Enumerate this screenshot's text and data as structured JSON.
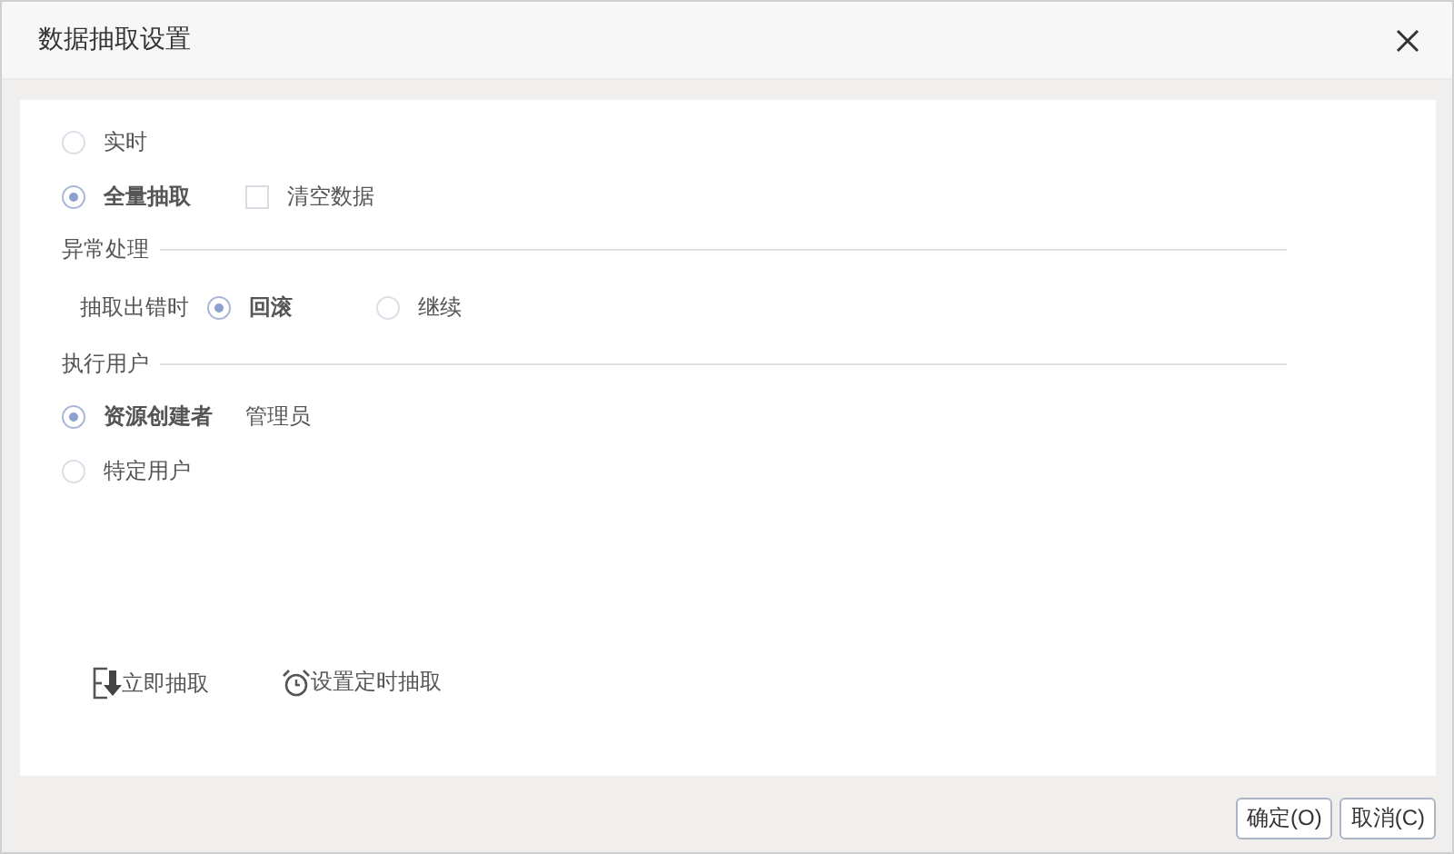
{
  "window": {
    "title": "数据抽取设置"
  },
  "mode_options": [
    {
      "label": "实时",
      "selected": false
    },
    {
      "label": "全量抽取",
      "selected": true,
      "checkbox": {
        "label": "清空数据",
        "checked": false
      }
    }
  ],
  "error_handling": {
    "title": "异常处理",
    "label": "抽取出错时",
    "options": [
      {
        "label": "回滚",
        "selected": true
      },
      {
        "label": "继续",
        "selected": false
      }
    ]
  },
  "exec_user": {
    "title": "执行用户",
    "options": [
      {
        "label": "资源创建者",
        "selected": true,
        "note": "管理员"
      },
      {
        "label": "特定用户",
        "selected": false
      }
    ]
  },
  "actions": [
    {
      "label": "立即抽取",
      "kind": "extract"
    },
    {
      "label": "设置定时抽取",
      "kind": "schedule"
    }
  ],
  "buttons": [
    "确定(O)",
    "取消(C)"
  ]
}
